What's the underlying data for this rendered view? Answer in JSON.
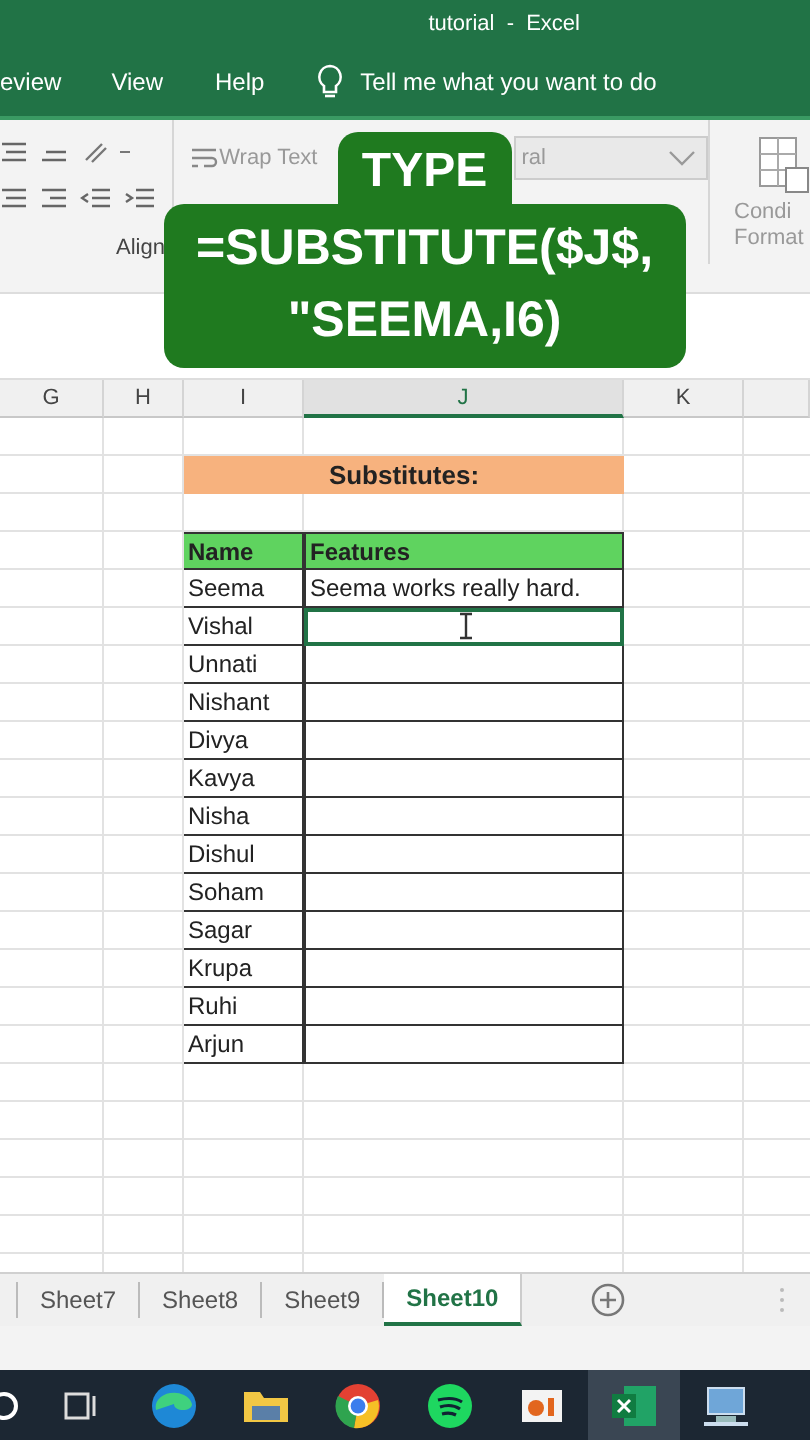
{
  "window": {
    "title": "tutorial  -  Excel"
  },
  "menu": [
    {
      "label": "eview"
    },
    {
      "label": "View"
    },
    {
      "label": "Help"
    }
  ],
  "tell_me": {
    "placeholder": "Tell me what you want to do"
  },
  "ribbon": {
    "wrap_text": "Wrap Text",
    "number_format": "ral",
    "group_label": "Align",
    "conditional_formatting": [
      "Condi",
      "Format"
    ]
  },
  "columns": [
    "G",
    "H",
    "I",
    "J",
    "K"
  ],
  "title_cell": "Substitutes:",
  "table": {
    "columns": [
      "Name",
      "Features"
    ],
    "rows": [
      {
        "name": "Seema",
        "features": "Seema works really hard.",
        "selected": false
      },
      {
        "name": "Vishal",
        "selected": true
      },
      {
        "name": "Unnati",
        "selected": false
      },
      {
        "name": "Nishant",
        "selected": false
      },
      {
        "name": "Divya",
        "selected": false
      },
      {
        "name": "Kavya",
        "selected": false
      },
      {
        "name": "Nisha",
        "selected": false
      },
      {
        "name": "Dishul",
        "selected": false
      },
      {
        "name": "Soham",
        "selected": false
      },
      {
        "name": "Sagar",
        "selected": false
      },
      {
        "name": "Krupa",
        "selected": false
      },
      {
        "name": "Ruhi",
        "selected": false
      },
      {
        "name": "Arjun",
        "selected": false
      }
    ]
  },
  "sheet_tabs": [
    {
      "label": "Sheet7",
      "selected": false
    },
    {
      "label": "Sheet8",
      "selected": false
    },
    {
      "label": "Sheet9",
      "selected": false
    },
    {
      "label": "Sheet10",
      "selected": true
    }
  ],
  "caption": [
    "TYPE",
    "=SUBSTITUTE($J$,",
    "\"SEEMA,I6)"
  ]
}
